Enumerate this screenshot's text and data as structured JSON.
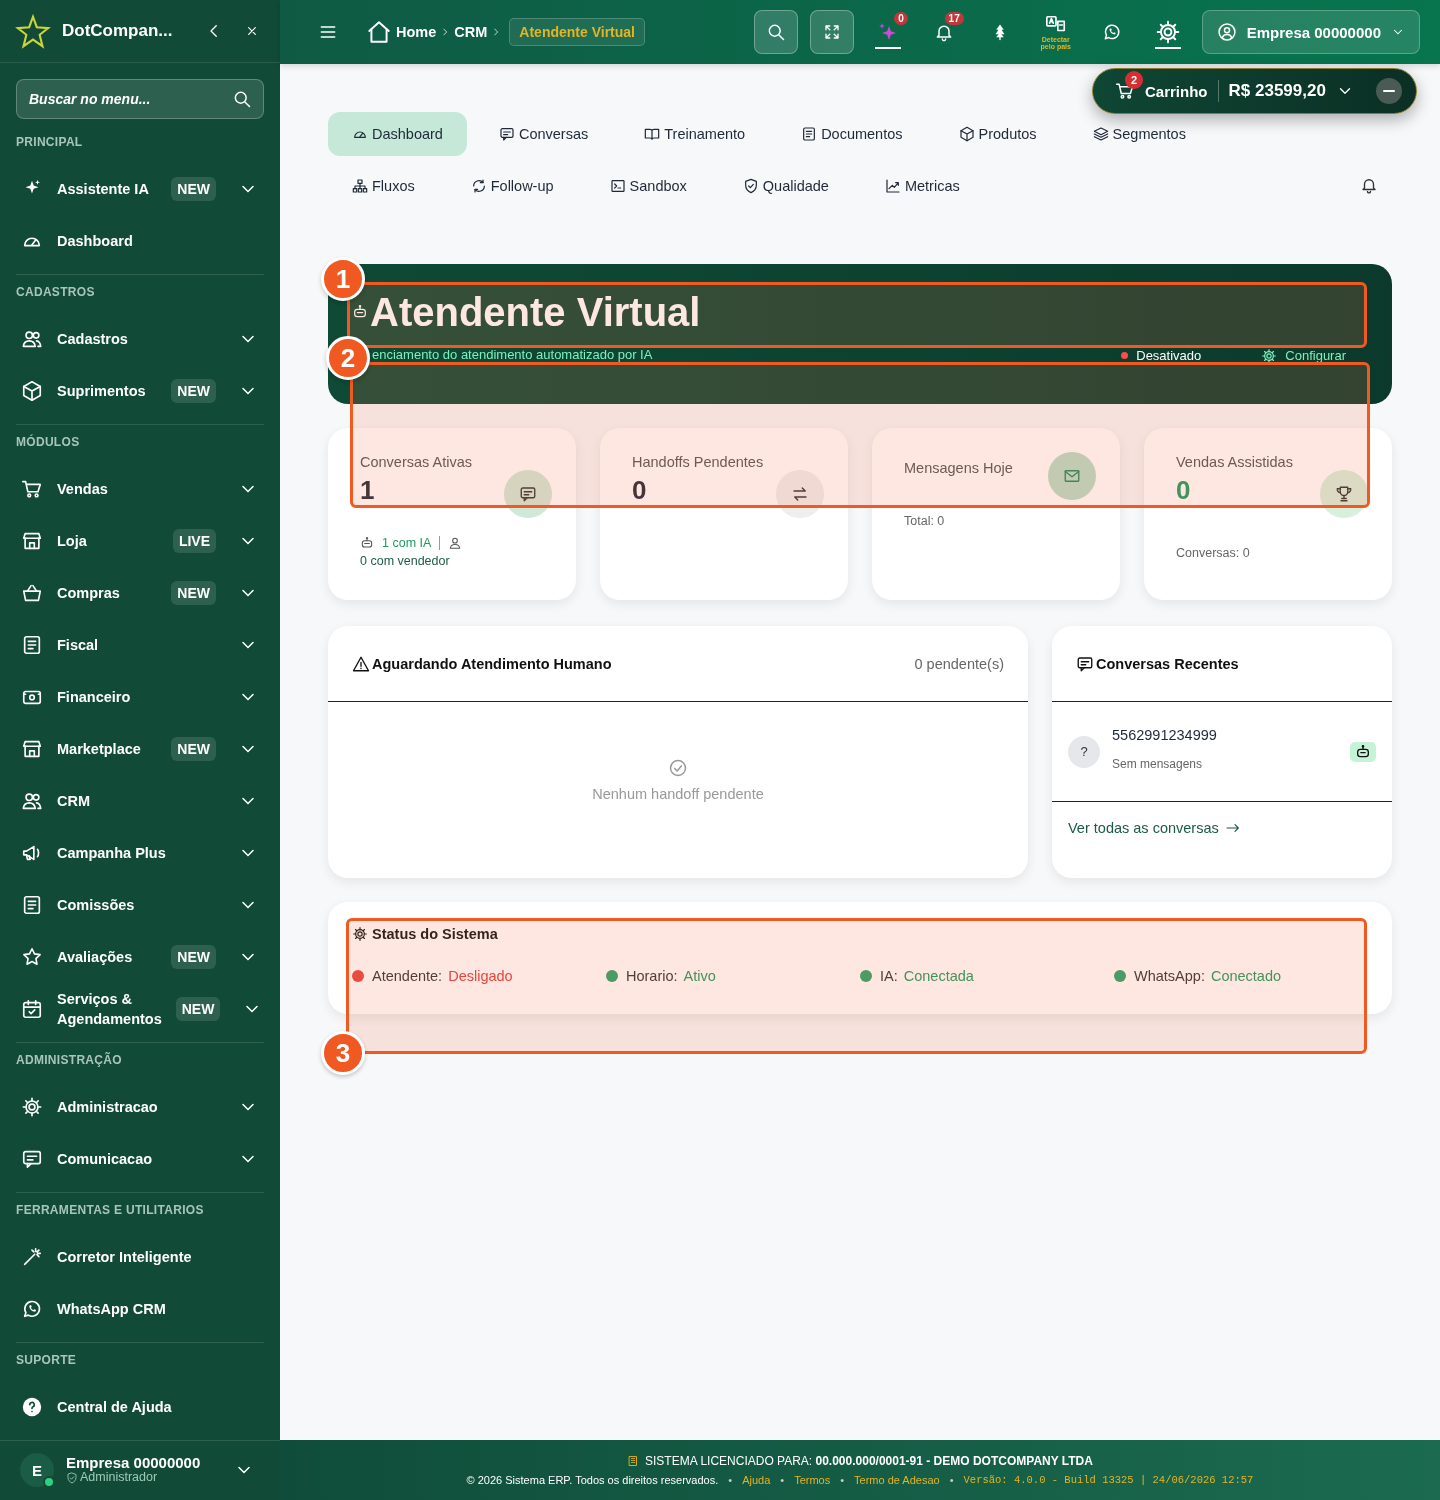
{
  "sidebar": {
    "brand": "DotCompan...",
    "search": {
      "placeholder": "Buscar no menu..."
    },
    "sections": [
      {
        "title": "PRINCIPAL",
        "items": [
          {
            "label": "Assistente IA",
            "badge": "NEW",
            "expandable": true
          },
          {
            "label": "Dashboard",
            "expandable": false
          }
        ]
      },
      {
        "title": "CADASTROS",
        "items": [
          {
            "label": "Cadastros",
            "expandable": true
          },
          {
            "label": "Suprimentos",
            "badge": "NEW",
            "expandable": true
          }
        ]
      },
      {
        "title": "MÓDULOS",
        "items": [
          {
            "label": "Vendas",
            "expandable": true
          },
          {
            "label": "Loja",
            "badge": "LIVE",
            "expandable": true
          },
          {
            "label": "Compras",
            "badge": "NEW",
            "expandable": true
          },
          {
            "label": "Fiscal",
            "expandable": true
          },
          {
            "label": "Financeiro",
            "expandable": true
          },
          {
            "label": "Marketplace",
            "badge": "NEW",
            "expandable": true
          },
          {
            "label": "CRM",
            "expandable": true
          },
          {
            "label": "Campanha Plus",
            "expandable": true
          },
          {
            "label": "Comissões",
            "expandable": true
          },
          {
            "label": "Avaliações",
            "badge": "NEW",
            "expandable": true
          },
          {
            "label": "Serviços & Agendamentos",
            "badge": "NEW",
            "expandable": true
          }
        ]
      },
      {
        "title": "ADMINISTRAÇÃO",
        "items": [
          {
            "label": "Administracao",
            "expandable": true
          },
          {
            "label": "Comunicacao",
            "expandable": true
          }
        ]
      },
      {
        "title": "FERRAMENTAS E UTILITARIOS",
        "items": [
          {
            "label": "Corretor Inteligente",
            "expandable": false
          },
          {
            "label": "WhatsApp CRM",
            "expandable": false
          }
        ]
      },
      {
        "title": "SUPORTE",
        "items": [
          {
            "label": "Central de Ajuda",
            "expandable": false
          }
        ]
      }
    ],
    "user": {
      "initial": "E",
      "name": "Empresa 00000000",
      "role": "Administrador",
      "online": true
    }
  },
  "topbar": {
    "breadcrumb": [
      "Home",
      "CRM"
    ],
    "current": "Atendente Virtual",
    "ai_count": "0",
    "notifications": "17",
    "language": "Detectar pelo pais",
    "account": "Empresa 00000000"
  },
  "tab_rows": [
    [
      {
        "label": "Dashboard",
        "selected": true
      },
      {
        "label": "Conversas",
        "selected": false
      },
      {
        "label": "Treinamento",
        "selected": false
      },
      {
        "label": "Documentos",
        "selected": false
      },
      {
        "label": "Produtos",
        "selected": false
      },
      {
        "label": "Segmentos",
        "selected": false
      }
    ],
    [
      {
        "label": "Fluxos",
        "selected": false
      },
      {
        "label": "Follow-up",
        "selected": false
      },
      {
        "label": "Sandbox",
        "selected": false
      },
      {
        "label": "Qualidade",
        "selected": false
      },
      {
        "label": "Metricas",
        "selected": false
      }
    ]
  ],
  "cart": {
    "count": "2",
    "label": "Carrinho",
    "total": "R$ 23599,20"
  },
  "hero": {
    "title": "Atendente Virtual",
    "subtitle": "enciamento do atendimento automatizado por IA",
    "status": {
      "label": "Desativado",
      "active": false
    },
    "configure": "Configurar"
  },
  "stats": [
    {
      "title": "Conversas Ativas",
      "value": "1",
      "breakdown": [
        "1 com IA",
        "0 com vendedor"
      ]
    },
    {
      "title": "Handoffs Pendentes",
      "value": "0"
    },
    {
      "title": "Mensagens Hoje",
      "note": "Total: 0"
    },
    {
      "title": "Vendas Assistidas",
      "value": "0",
      "highlight": true,
      "note": "Conversas: 0"
    }
  ],
  "handoffs": {
    "title": "Aguardando Atendimento Humano",
    "count": "0 pendente(s)",
    "empty": "Nenhum handoff pendente"
  },
  "recent": {
    "title": "Conversas Recentes",
    "items": [
      {
        "avatar": "?",
        "name": "5562991234999",
        "preview": "Sem mensagens"
      }
    ],
    "link": "Ver todas as conversas"
  },
  "status": {
    "title": "Status do Sistema",
    "items": [
      {
        "label": "Atendente:",
        "value": "Desligado",
        "ok": false
      },
      {
        "label": "Horario:",
        "value": "Ativo",
        "ok": true
      },
      {
        "label": "IA:",
        "value": "Conectada",
        "ok": true
      },
      {
        "label": "WhatsApp:",
        "value": "Conectado",
        "ok": true
      }
    ]
  },
  "annotations": [
    {
      "label": "1"
    },
    {
      "label": "2"
    },
    {
      "label": "3"
    }
  ],
  "footer": {
    "license": "SISTEMA LICENCIADO PARA: **00.000.000/0001-91 - DEMO DOTCOMPANY LTDA**",
    "line": [
      {
        "kind": "text",
        "text": "© 2026 Sistema ERP. Todos os direitos reservados."
      },
      {
        "kind": "sep",
        "text": "•"
      },
      {
        "kind": "link",
        "text": "Ajuda"
      },
      {
        "kind": "sep",
        "text": "•"
      },
      {
        "kind": "link",
        "text": "Termos"
      },
      {
        "kind": "sep",
        "text": "•"
      },
      {
        "kind": "link",
        "text": "Termo de Adesao"
      },
      {
        "kind": "sep",
        "text": "•"
      },
      {
        "kind": "version",
        "text": "Versão: 4.0.0 - Build 13325 | 24/06/2026 12:57"
      }
    ]
  }
}
